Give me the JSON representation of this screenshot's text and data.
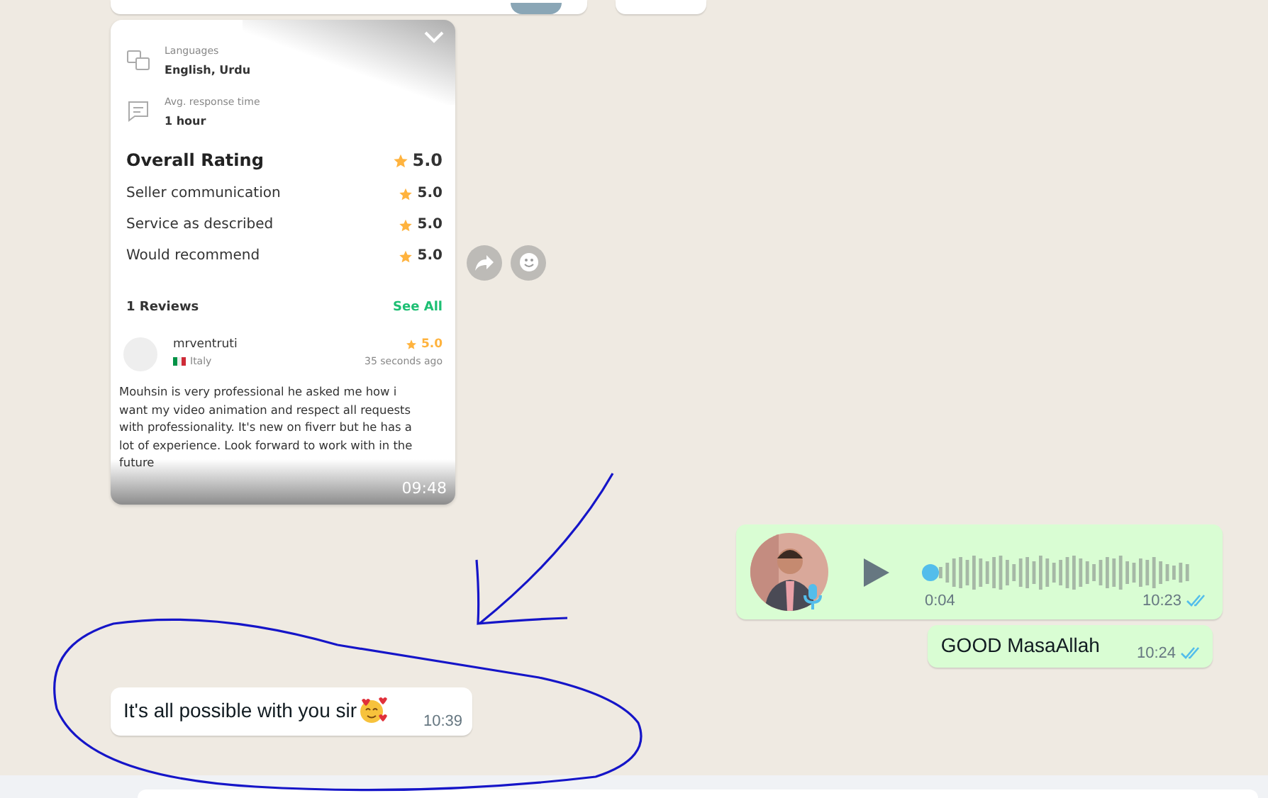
{
  "top_bubbles": [
    {
      "kind": "avatar"
    },
    {
      "kind": "plain"
    }
  ],
  "image_message": {
    "time": "09:48",
    "card": {
      "languages": {
        "label": "Languages",
        "value": "English, Urdu"
      },
      "response": {
        "label": "Avg. response time",
        "value": "1 hour"
      },
      "overall": {
        "label": "Overall Rating",
        "value": "5.0"
      },
      "ratings": [
        {
          "label": "Seller communication",
          "value": "5.0"
        },
        {
          "label": "Service as described",
          "value": "5.0"
        },
        {
          "label": "Would recommend",
          "value": "5.0"
        }
      ],
      "reviews_count": "1 Reviews",
      "see_all": "See All",
      "review": {
        "name": "mrventruti",
        "country": "Italy",
        "rating": "5.0",
        "age": "35 seconds ago",
        "text": "Mouhsin is very professional he asked me how i want my video animation and respect all requests with professionality. It's new on fiverr but he has a lot of experience. Look forward to work with in the future"
      }
    }
  },
  "voice_message": {
    "duration": "0:04",
    "time": "10:23",
    "read": true,
    "level": 0
  },
  "outgoing_text": {
    "text": "GOOD MasaAllah",
    "time": "10:24",
    "read": true
  },
  "incoming_text": {
    "text": "It's all possible with you sir",
    "time": "10:39"
  }
}
